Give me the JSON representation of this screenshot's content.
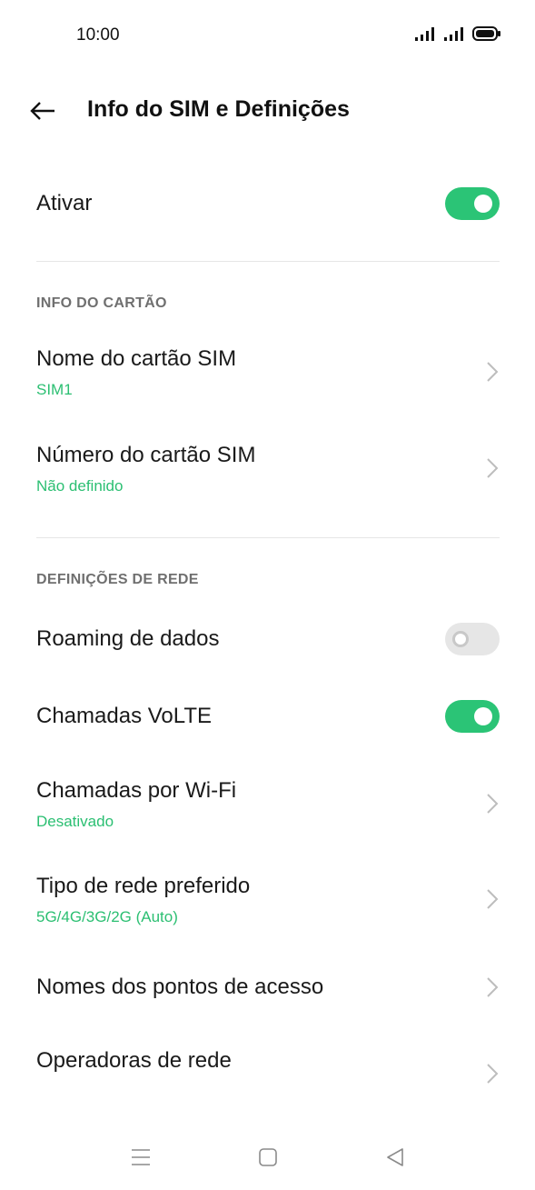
{
  "status_bar": {
    "time": "10:00",
    "icons": [
      "signal-icon",
      "signal-icon",
      "battery-icon"
    ]
  },
  "header": {
    "title": "Info do SIM e Definições",
    "back_icon": "arrow-left-icon"
  },
  "activate": {
    "label": "Ativar",
    "enabled": true
  },
  "sections": {
    "card_info": "INFO DO CARTÃO",
    "network": "DEFINIÇÕES DE REDE"
  },
  "card_rows": {
    "sim_name": {
      "title": "Nome do cartão SIM",
      "value": "SIM1"
    },
    "sim_number": {
      "title": "Número do cartão SIM",
      "value": "Não definido"
    }
  },
  "network_rows": {
    "roaming": {
      "title": "Roaming de dados",
      "enabled": false
    },
    "volte": {
      "title": "Chamadas VoLTE",
      "enabled": true
    },
    "wifi_calls": {
      "title": "Chamadas por Wi-Fi",
      "value": "Desativado"
    },
    "network_type": {
      "title": "Tipo de rede preferido",
      "value": "5G/4G/3G/2G (Auto)"
    },
    "apn": {
      "title": "Nomes dos pontos de acesso"
    },
    "operators": {
      "title": "Operadoras de rede"
    }
  },
  "nav_bar": {
    "icons": [
      "menu-icon",
      "home-square-icon",
      "back-triangle-icon"
    ]
  },
  "colors": {
    "accent": "#2bc476",
    "subtitle": "#2bbf72",
    "section_label": "#6f6f6f",
    "toggle_off": "#e6e6e6"
  }
}
